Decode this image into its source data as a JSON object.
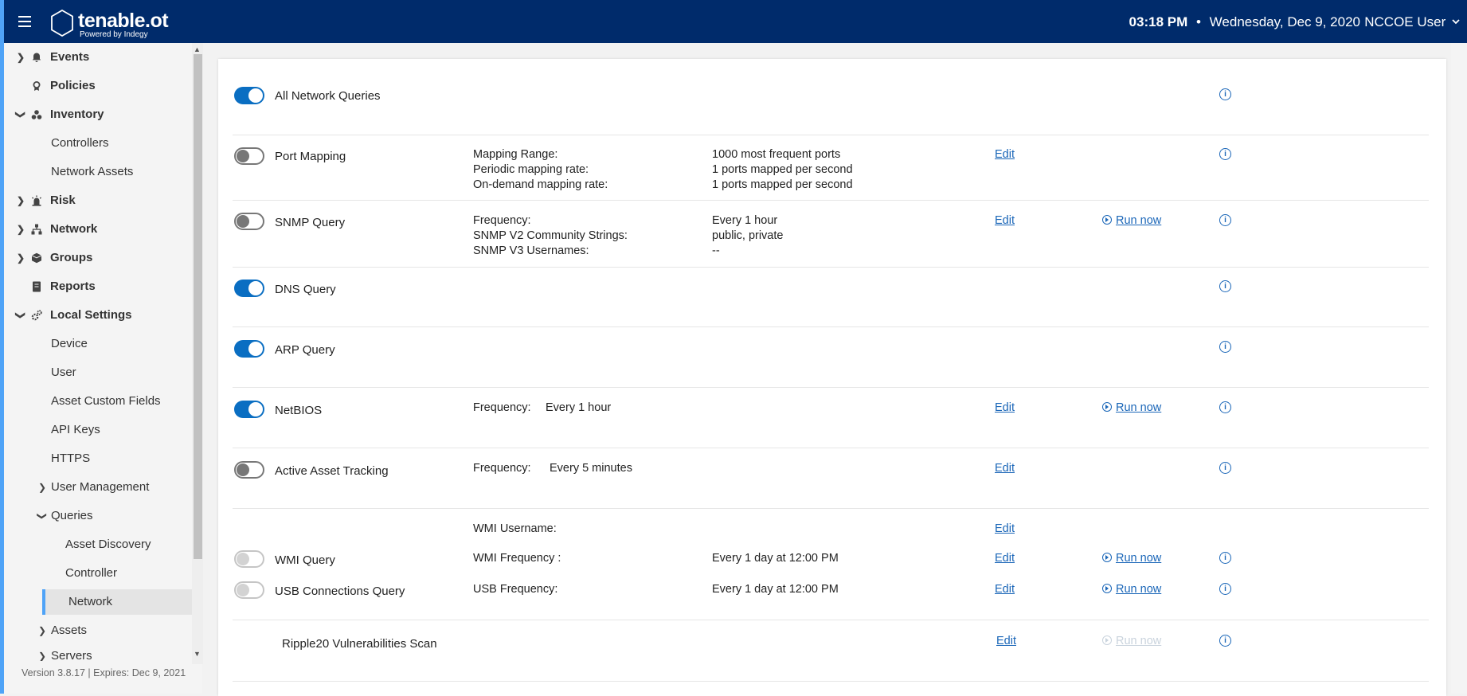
{
  "header": {
    "logo_name": "tenable.ot",
    "logo_sub": "Powered by Indegy",
    "time": "03:18 PM",
    "separator": "•",
    "date": "Wednesday, Dec 9, 2020",
    "user": "NCCOE User"
  },
  "sidebar": {
    "items": [
      {
        "label": "Events"
      },
      {
        "label": "Policies"
      },
      {
        "label": "Inventory"
      },
      {
        "label": "Controllers"
      },
      {
        "label": "Network Assets"
      },
      {
        "label": "Risk"
      },
      {
        "label": "Network"
      },
      {
        "label": "Groups"
      },
      {
        "label": "Reports"
      },
      {
        "label": "Local Settings"
      },
      {
        "label": "Device"
      },
      {
        "label": "User"
      },
      {
        "label": "Asset Custom Fields"
      },
      {
        "label": "API Keys"
      },
      {
        "label": "HTTPS"
      },
      {
        "label": "User Management"
      },
      {
        "label": "Queries"
      },
      {
        "label": "Asset Discovery"
      },
      {
        "label": "Controller"
      },
      {
        "label": "Network"
      },
      {
        "label": "Assets"
      },
      {
        "label": "Servers"
      }
    ],
    "version": "Version 3.8.17 | Expires: Dec 9, 2021"
  },
  "queries": {
    "all": {
      "name": "All Network Queries",
      "enabled": true
    },
    "port_mapping": {
      "name": "Port Mapping",
      "enabled": false,
      "labels": [
        "Mapping Range:",
        "Periodic mapping rate:",
        "On-demand mapping rate:"
      ],
      "values": [
        "1000 most frequent ports",
        "1 ports mapped per second",
        "1 ports mapped per second"
      ]
    },
    "snmp": {
      "name": "SNMP Query",
      "enabled": false,
      "labels": [
        "Frequency:",
        "SNMP V2 Community Strings:",
        "SNMP V3 Usernames:"
      ],
      "values": [
        "Every 1 hour",
        "public, private",
        "--"
      ]
    },
    "dns": {
      "name": "DNS Query",
      "enabled": true
    },
    "arp": {
      "name": "ARP Query",
      "enabled": true
    },
    "netbios": {
      "name": "NetBIOS",
      "enabled": true,
      "label": "Frequency:",
      "value": "Every 1 hour"
    },
    "active_tracking": {
      "name": "Active Asset Tracking",
      "enabled": false,
      "label": "Frequency:",
      "value": "Every 5 minutes"
    },
    "wmi_username_label": "WMI Username:",
    "wmi": {
      "name": "WMI Query",
      "enabled": false,
      "label": "WMI Frequency :",
      "value": "Every 1 day at 12:00 PM"
    },
    "usb": {
      "name": "USB Connections Query",
      "enabled": false,
      "label": "USB Frequency:",
      "value": "Every 1 day at 12:00 PM"
    },
    "ripple": {
      "name": "Ripple20 Vulnerabilities Scan"
    }
  },
  "actions": {
    "edit": "Edit",
    "run_now": "Run now",
    "info": "i"
  },
  "colors": {
    "topbar": "#002b6b",
    "accent": "#4fa3f7",
    "toggle_on": "#0a6ec2",
    "link": "#1a66b8"
  }
}
